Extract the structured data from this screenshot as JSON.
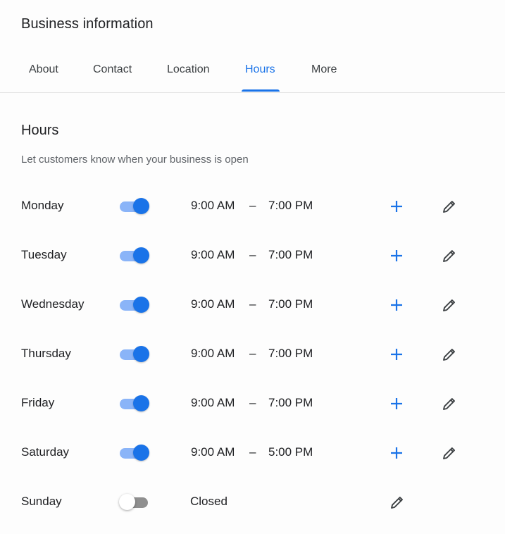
{
  "header": {
    "title": "Business information"
  },
  "tabs": [
    {
      "label": "About",
      "active": false
    },
    {
      "label": "Contact",
      "active": false
    },
    {
      "label": "Location",
      "active": false
    },
    {
      "label": "Hours",
      "active": true
    },
    {
      "label": "More",
      "active": false
    }
  ],
  "hours": {
    "title": "Hours",
    "description": "Let customers know when your business is open",
    "separator": "–",
    "days": [
      {
        "day": "Monday",
        "open": true,
        "from": "9:00 AM",
        "to": "7:00 PM"
      },
      {
        "day": "Tuesday",
        "open": true,
        "from": "9:00 AM",
        "to": "7:00 PM"
      },
      {
        "day": "Wednesday",
        "open": true,
        "from": "9:00 AM",
        "to": "7:00 PM"
      },
      {
        "day": "Thursday",
        "open": true,
        "from": "9:00 AM",
        "to": "7:00 PM"
      },
      {
        "day": "Friday",
        "open": true,
        "from": "9:00 AM",
        "to": "7:00 PM"
      },
      {
        "day": "Saturday",
        "open": true,
        "from": "9:00 AM",
        "to": "5:00 PM"
      },
      {
        "day": "Sunday",
        "open": false,
        "closed_label": "Closed"
      }
    ]
  },
  "icons": {
    "add": "plus-icon",
    "edit": "pencil-icon"
  },
  "colors": {
    "accent": "#1a73e8",
    "toggle_track_on": "#8ab4f8",
    "toggle_track_off": "#8f8f8f",
    "text_primary": "#202124",
    "text_secondary": "#5f6368"
  }
}
